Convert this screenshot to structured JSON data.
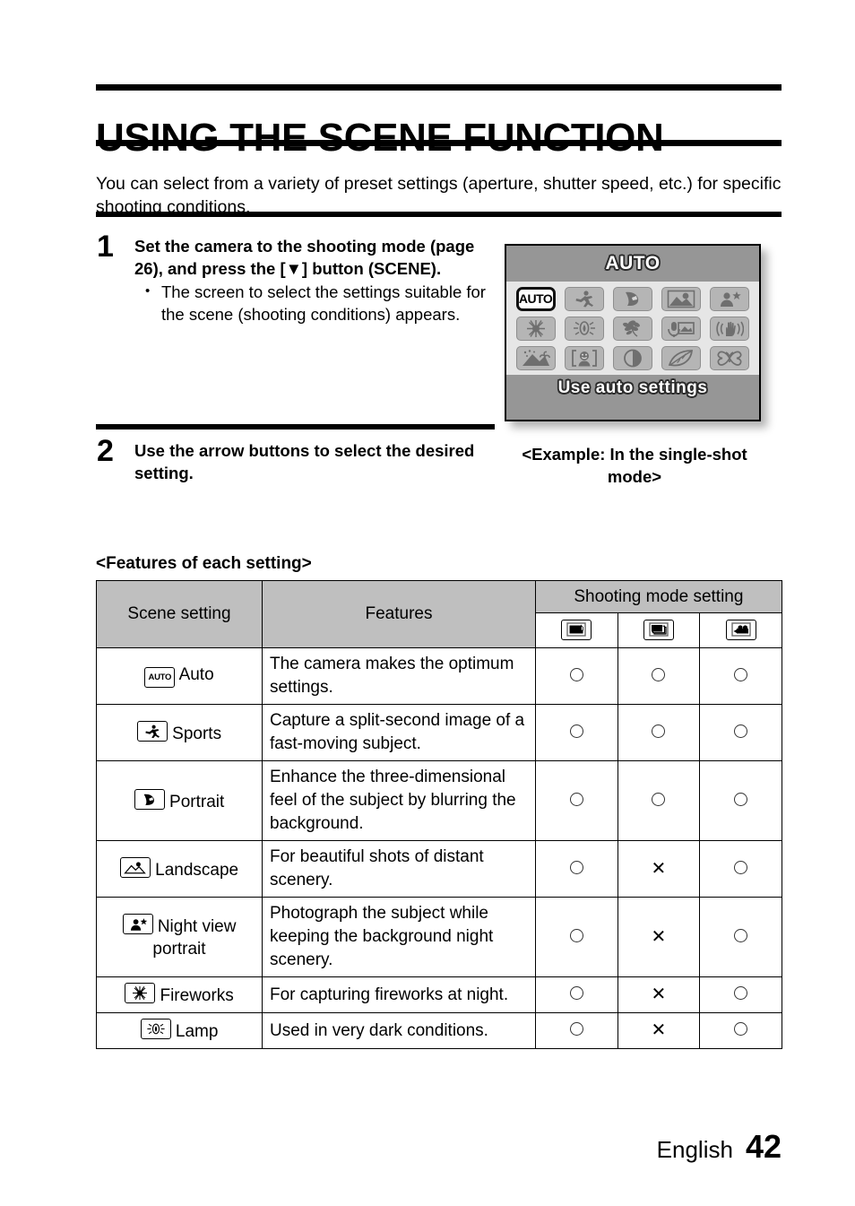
{
  "document": {
    "title": "USING THE SCENE FUNCTION",
    "intro": "You can select from a variety of preset settings (aperture, shutter speed, etc.) for specific shooting conditions."
  },
  "steps": [
    {
      "number": "1",
      "heading": "Set the camera to the shooting mode (page 26), and press the [▼] button (SCENE).",
      "bullets": [
        "The screen to select the settings suitable for the scene (shooting conditions) appears."
      ]
    },
    {
      "number": "2",
      "heading": "Use the arrow buttons to select the desired setting.",
      "bullets": []
    }
  ],
  "lcd_screen": {
    "top_label": "AUTO",
    "bottom_label": "Use auto settings",
    "caption": "<Example: In the single-shot mode>",
    "colors": {
      "band": "#969696",
      "grid_background": "#e6e6e6",
      "tile": "#b5b5b5",
      "selected_tile": "#ffffff"
    },
    "tiles": [
      {
        "icon": "auto-icon",
        "label": "AUTO",
        "selected": true
      },
      {
        "icon": "sports-runner-icon",
        "label": "Sports",
        "selected": false
      },
      {
        "icon": "portrait-face-icon",
        "label": "Portrait",
        "selected": false
      },
      {
        "icon": "landscape-icon",
        "label": "Landscape",
        "selected": false
      },
      {
        "icon": "night-view-portrait-icon",
        "label": "Night view portrait",
        "selected": false
      },
      {
        "icon": "fireworks-icon",
        "label": "Fireworks",
        "selected": false
      },
      {
        "icon": "lamp-icon",
        "label": "Lamp",
        "selected": false
      },
      {
        "icon": "flower-icon",
        "label": "Flower",
        "selected": false
      },
      {
        "icon": "sound-photo-icon",
        "label": "Sound photo",
        "selected": false
      },
      {
        "icon": "anti-shake-hand-icon",
        "label": "Anti-shake",
        "selected": false
      },
      {
        "icon": "snow-beach-icon",
        "label": "Snow & beach",
        "selected": false
      },
      {
        "icon": "face-detect-icon",
        "label": "Face detect",
        "selected": false
      },
      {
        "icon": "contrast-icon",
        "label": "Contrast",
        "selected": false
      },
      {
        "icon": "leaf-icon",
        "label": "Leaf",
        "selected": false
      },
      {
        "icon": "butterfly-icon",
        "label": "Butterfly",
        "selected": false
      }
    ]
  },
  "features_section": {
    "heading": "<Features of each setting>",
    "table": {
      "headers": {
        "scene": "Scene setting",
        "features": "Features",
        "shooting_mode": "Shooting mode setting"
      },
      "mode_icons": [
        {
          "icon": "single-shot-icon",
          "name": "Single-shot"
        },
        {
          "icon": "sequential-shot-icon",
          "name": "Sequential shot"
        },
        {
          "icon": "video-clip-icon",
          "name": "Video clip"
        }
      ],
      "rows": [
        {
          "icon": "auto-icon",
          "scene": "Auto",
          "features": "The camera makes the optimum settings.",
          "marks": [
            "circle",
            "circle",
            "circle"
          ]
        },
        {
          "icon": "sports-runner-icon",
          "scene": "Sports",
          "features": "Capture a split-second image of a fast-moving subject.",
          "marks": [
            "circle",
            "circle",
            "circle"
          ]
        },
        {
          "icon": "portrait-face-icon",
          "scene": "Portrait",
          "features": "Enhance the three-dimensional feel of the subject by blurring the background.",
          "marks": [
            "circle",
            "circle",
            "circle"
          ]
        },
        {
          "icon": "landscape-icon",
          "scene": "Landscape",
          "features": "For beautiful shots of distant scenery.",
          "marks": [
            "circle",
            "cross",
            "circle"
          ]
        },
        {
          "icon": "night-view-portrait-icon",
          "scene": "Night view portrait",
          "features": "Photograph the subject while keeping the background night scenery.",
          "marks": [
            "circle",
            "cross",
            "circle"
          ]
        },
        {
          "icon": "fireworks-icon",
          "scene": "Fireworks",
          "features": "For capturing fireworks at night.",
          "marks": [
            "circle",
            "cross",
            "circle"
          ]
        },
        {
          "icon": "lamp-icon",
          "scene": "Lamp",
          "features": "Used in very dark conditions.",
          "marks": [
            "circle",
            "cross",
            "circle"
          ]
        }
      ]
    }
  },
  "footer": {
    "language": "English",
    "page_number": "42"
  }
}
